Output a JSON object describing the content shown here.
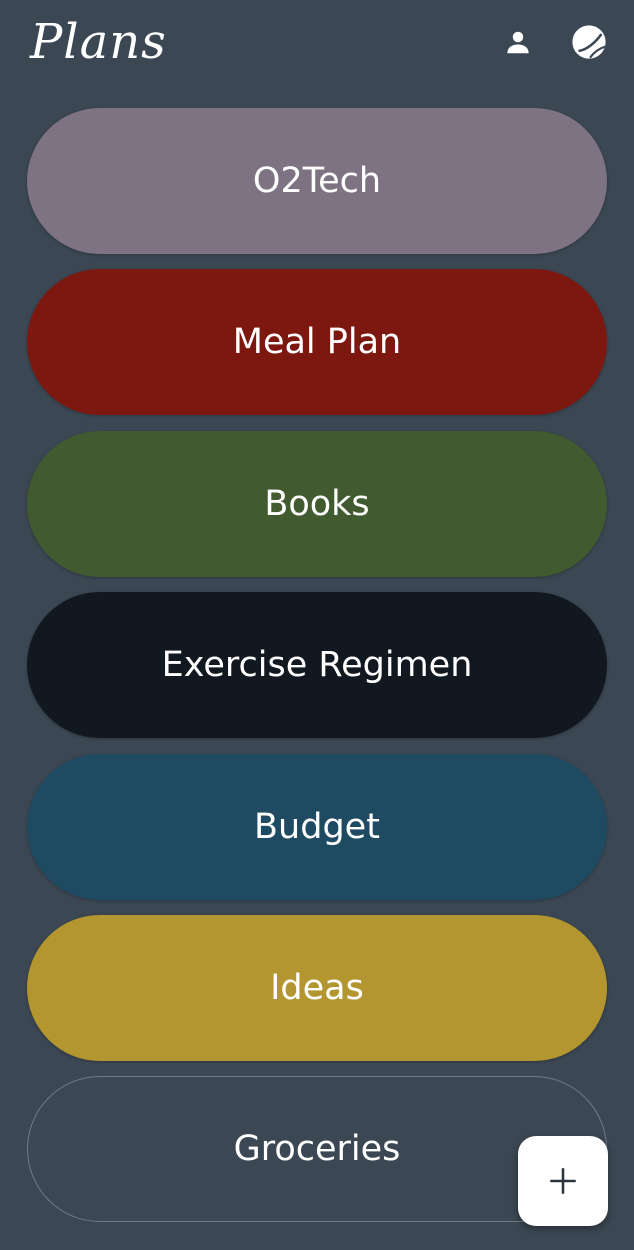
{
  "header": {
    "title": "Plans",
    "profile_icon": "person-icon",
    "theme_icon": "theme-toggle-icon"
  },
  "plans": [
    {
      "label": "O2Tech",
      "color": "#7e7383",
      "style": "filled"
    },
    {
      "label": "Meal Plan",
      "color": "#7d1810",
      "style": "filled"
    },
    {
      "label": "Books",
      "color": "#425a2f",
      "style": "filled"
    },
    {
      "label": "Exercise Regimen",
      "color": "#121820",
      "style": "filled"
    },
    {
      "label": "Budget",
      "color": "#1f4b62",
      "style": "filled"
    },
    {
      "label": "Ideas",
      "color": "#b49631",
      "style": "filled"
    },
    {
      "label": "Groceries",
      "color": "#3b4753",
      "style": "outlined"
    }
  ],
  "fab": {
    "icon": "plus-icon"
  },
  "colors": {
    "background": "#3b4753",
    "text": "#ffffff"
  }
}
